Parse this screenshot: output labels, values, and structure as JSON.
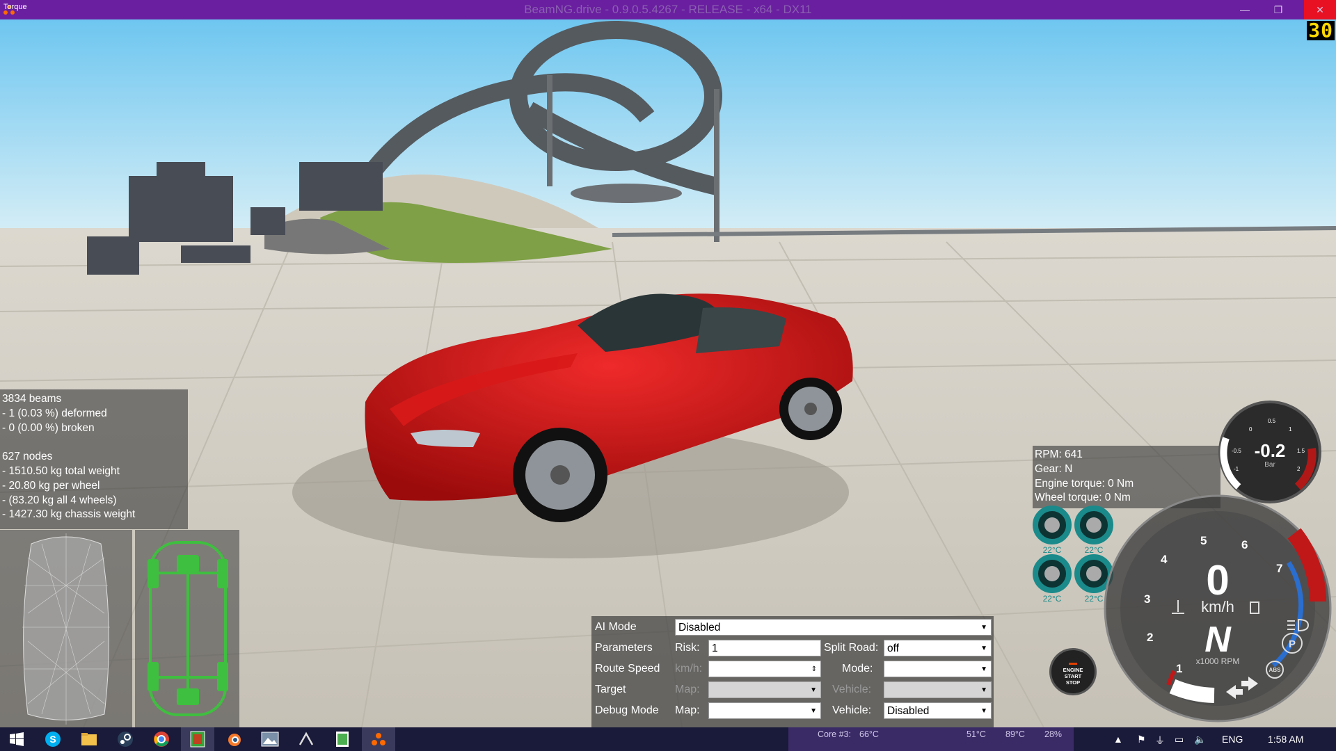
{
  "window": {
    "title": "BeamNG.drive - 0.9.0.5.4267 - RELEASE - x64 - DX11",
    "min_glyph": "—",
    "max_glyph": "❐",
    "close_glyph": "✕"
  },
  "fps": "30",
  "beams_panel": {
    "lines": [
      "3834 beams",
      "- 1 (0.03 %) deformed",
      "- 0 (0.00 %) broken",
      "",
      "627 nodes",
      "- 1510.50 kg total weight",
      "- 20.80 kg per wheel",
      "- (83.20 kg all 4 wheels)",
      "- 1427.30 kg chassis weight"
    ]
  },
  "torque_panel": {
    "label": "Torque"
  },
  "rpm_panel": {
    "lines": [
      "RPM: 641",
      "Gear: N",
      "Engine torque: 0 Nm",
      "Wheel torque: 0 Nm"
    ]
  },
  "tires": {
    "temps": [
      "22°C",
      "22°C",
      "22°C",
      "22°C"
    ],
    "color": "#1a8a8a"
  },
  "boost_gauge": {
    "value": "-0.2",
    "unit": "Bar",
    "ticks": [
      "-1",
      "-0.5",
      "0",
      "0.5",
      "1",
      "1.5",
      "2"
    ]
  },
  "speedometer": {
    "speed": "0",
    "speed_unit": "km/h",
    "gear": "N",
    "rpm_unit": "x1000 RPM",
    "rpm_ticks": [
      "1",
      "2",
      "3",
      "4",
      "5",
      "6",
      "7"
    ],
    "parking_label": "P",
    "abs_label": "ABS",
    "redline_color": "#c01818",
    "fuel_color": "#2a6ed0"
  },
  "engine_button": {
    "line1": "ENGINE",
    "line2": "START",
    "line3": "STOP"
  },
  "ai_panel": {
    "ai_mode_label": "AI Mode",
    "ai_mode_value": "Disabled",
    "parameters_label": "Parameters",
    "risk_label": "Risk:",
    "risk_value": "1",
    "split_road_label": "Split Road:",
    "split_road_value": "off",
    "route_speed_label": "Route Speed",
    "kmh_label": "km/h:",
    "kmh_value": "",
    "mode_label": "Mode:",
    "mode_value": "",
    "target_label": "Target",
    "target_map_label": "Map:",
    "target_vehicle_label": "Vehicle:",
    "debug_label": "Debug Mode",
    "debug_map_label": "Map:",
    "debug_map_value": "",
    "debug_vehicle_label": "Vehicle:",
    "debug_vehicle_value": "Disabled"
  },
  "taskbar": {
    "apps": [
      "windows-start",
      "skype",
      "file-explorer",
      "steam",
      "chrome",
      "app-green",
      "blender",
      "photos",
      "app-dark",
      "notepad",
      "beamng"
    ],
    "status": {
      "core": "Core #3:",
      "core_temp": "66°C",
      "t2": "51°C",
      "t3": "89°C",
      "load": "28%"
    },
    "lang": "ENG",
    "time": "1:58 AM"
  }
}
